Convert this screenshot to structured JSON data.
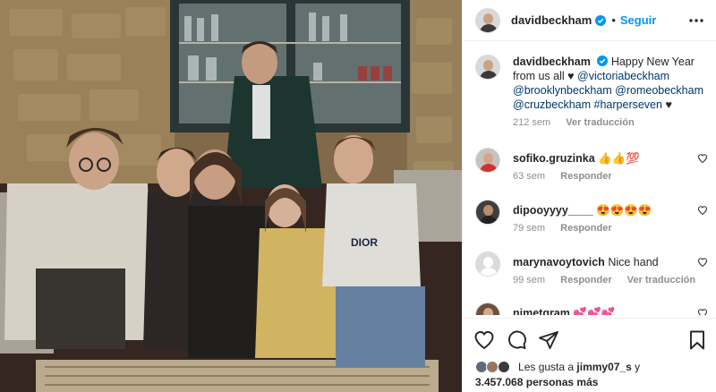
{
  "post": {
    "author": "davidbeckham",
    "follow_label": "Seguir",
    "separator": "•",
    "caption_prefix": "Happy New Year from us all",
    "caption_mentions": [
      "@victoriabeckham",
      "@brooklynbeckham",
      "@romeobeckham",
      "@cruzbeckham",
      "#harperseven"
    ],
    "caption_heart": "♥",
    "caption_heart_tail": "♥",
    "time": "212 sem",
    "translate_label": "Ver traducción"
  },
  "comments": [
    {
      "user": "sofiko.gruzinka",
      "text": "👍👍💯",
      "time": "63 sem",
      "reply": "Responder",
      "translate": ""
    },
    {
      "user": "dipooyyyy____",
      "text": "😍😍😍😍",
      "time": "79 sem",
      "reply": "Responder",
      "translate": ""
    },
    {
      "user": "marynavoytovich",
      "text": "Nice hand",
      "time": "99 sem",
      "reply": "Responder",
      "translate": "Ver traducción"
    },
    {
      "user": "nimetgram",
      "text": "💕💕💕",
      "time": "",
      "reply": "",
      "translate": ""
    }
  ],
  "likes": {
    "prefix": "Les gusta a",
    "user": "jimmy07_s",
    "connector": "y",
    "count": "3.457.068",
    "suffix": "personas más"
  },
  "icons": [
    "verified-badge-icon",
    "more-options-icon",
    "like-icon",
    "comment-icon",
    "share-icon",
    "save-icon"
  ],
  "colors": {
    "accent": "#0095f6",
    "mention": "#00376b",
    "muted": "#8e8e8e"
  }
}
